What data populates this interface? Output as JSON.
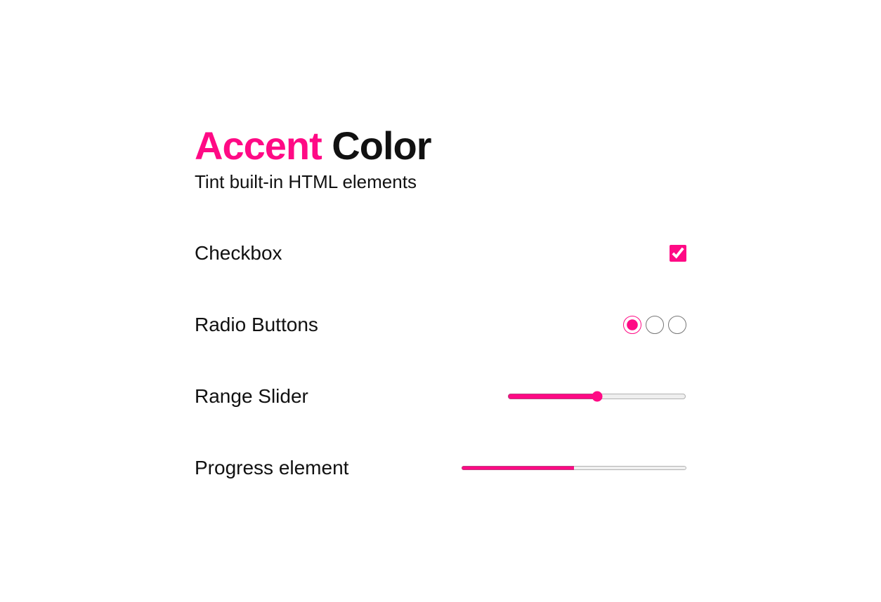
{
  "title": {
    "accent_word": "Accent",
    "rest": " Color"
  },
  "subtitle": "Tint built-in HTML elements",
  "accent_color": "#ff0a85",
  "rows": {
    "checkbox": {
      "label": "Checkbox",
      "checked": true
    },
    "radio": {
      "label": "Radio Buttons",
      "options_count": 3,
      "selected_index": 0
    },
    "range": {
      "label": "Range Slider",
      "value": 50,
      "min": 0,
      "max": 100
    },
    "progress": {
      "label": "Progress element",
      "value": 50,
      "max": 100
    }
  }
}
